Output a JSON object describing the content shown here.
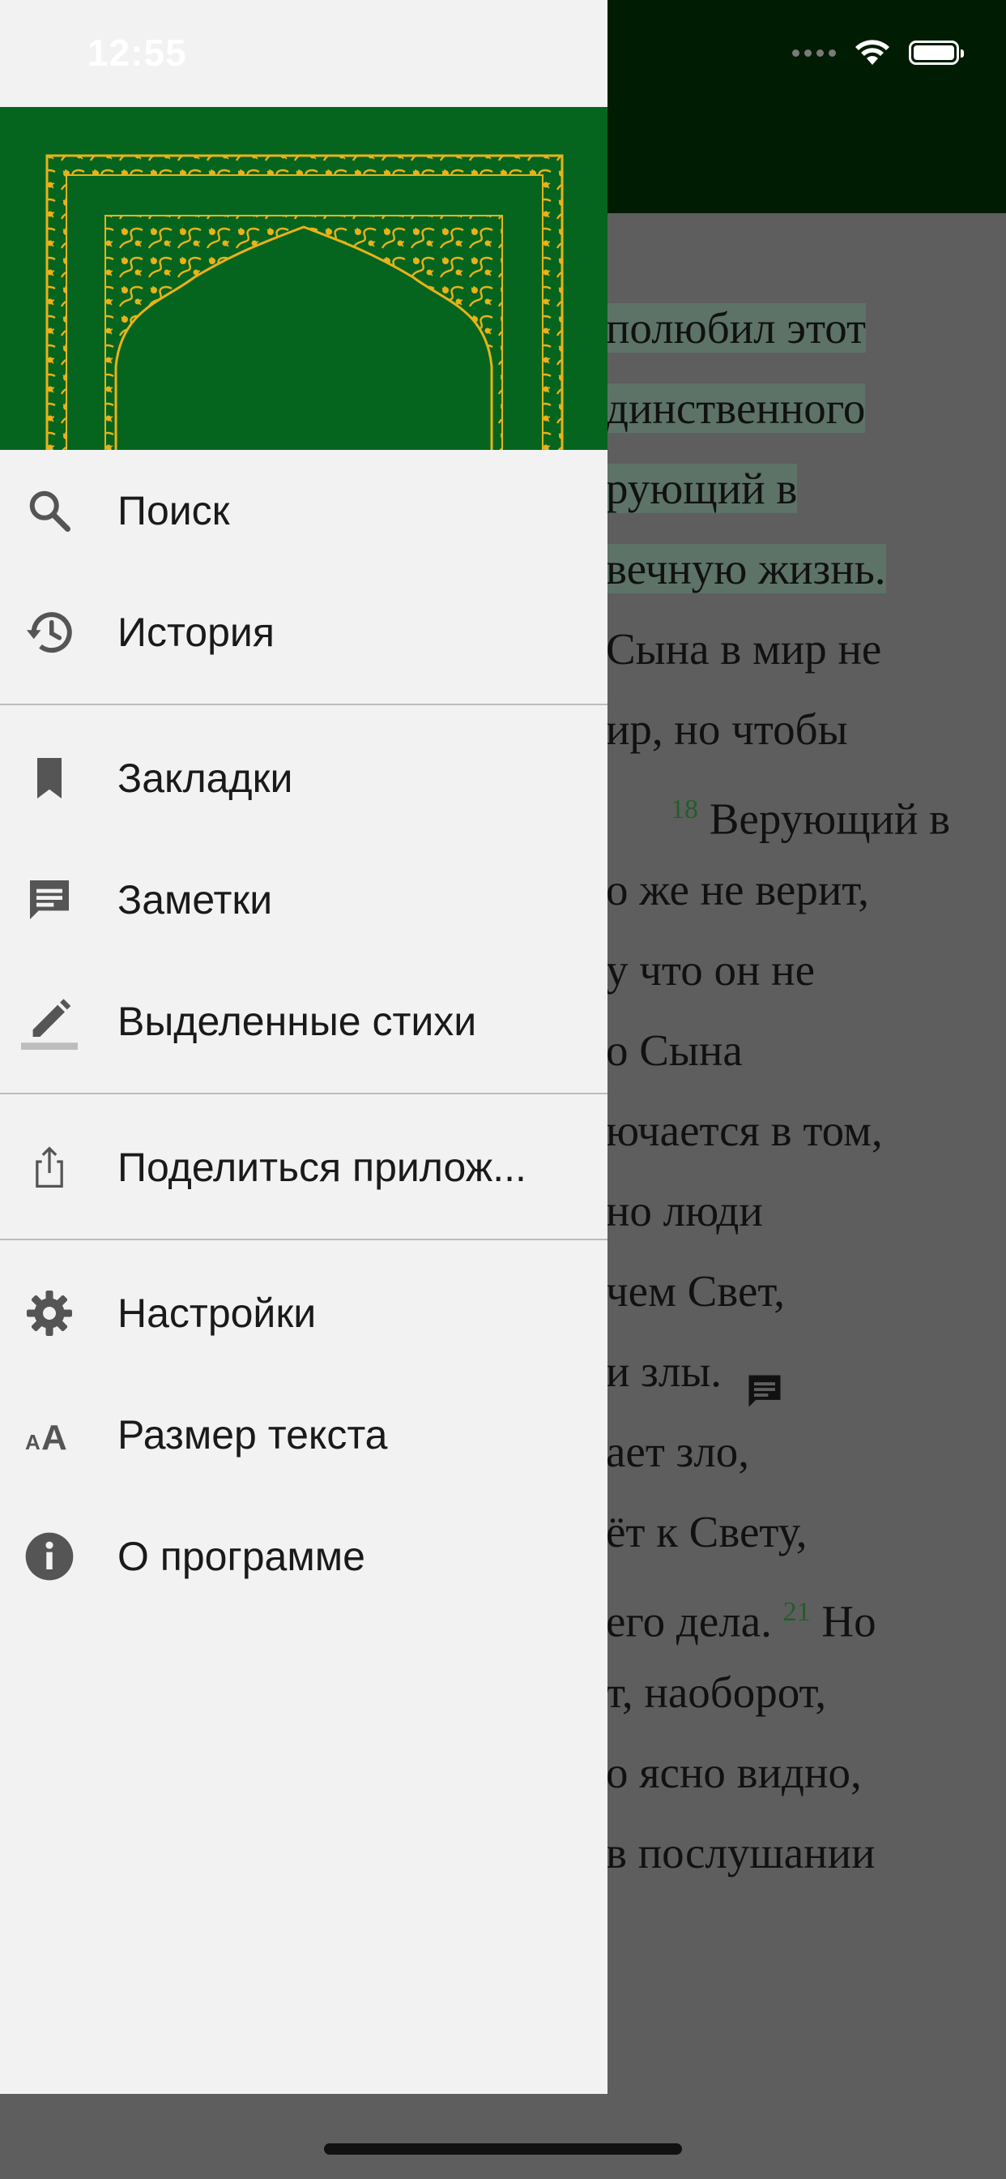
{
  "status_bar": {
    "time": "12:55"
  },
  "reader": {
    "lines": [
      {
        "t": "полюбил этот",
        "hl": true
      },
      {
        "t": "динственного",
        "hl": true
      },
      {
        "t": "рующий в",
        "hl": true
      },
      {
        "t": "вечную жизнь.",
        "hl": true
      },
      {
        "t": "Сына в мир не",
        "hl": false
      },
      {
        "t": "ир, но чтобы",
        "hl": false
      },
      {
        "t": "Верующий в",
        "hl": false,
        "verse": "18"
      },
      {
        "t": "о же не верит,",
        "hl": false
      },
      {
        "t": "у что он не",
        "hl": false
      },
      {
        "t": "о Сына",
        "hl": false
      },
      {
        "t": "ючается в том,",
        "hl": false
      },
      {
        "t": "но люди",
        "hl": false
      },
      {
        "t": "чем Свет,",
        "hl": false
      },
      {
        "t": "и злы.",
        "hl": false
      },
      {
        "t": "ает зло,",
        "hl": false
      },
      {
        "t": "ёт к Свету,",
        "hl": false
      },
      {
        "t": "его дела.",
        "hl": false,
        "verse_after": "21",
        "after": "Но"
      },
      {
        "t": "т, наоборот,",
        "hl": false
      },
      {
        "t": "о ясно видно,",
        "hl": false
      },
      {
        "t": "в послушании",
        "hl": false
      }
    ],
    "highlight_color": "#5d7368",
    "verse_number_color": "#245d2a"
  },
  "drawer": {
    "banner_color": "#05651f",
    "ornament_color": "#e9b21a",
    "menu": {
      "search": "Поиск",
      "history": "История",
      "bookmarks": "Закладки",
      "notes": "Заметки",
      "highlights": "Выделенные стихи",
      "share": "Поделиться прилож...",
      "settings": "Настройки",
      "text_size": "Размер текста",
      "about": "О программе"
    },
    "icons": {
      "search": "search-icon",
      "history": "history-icon",
      "bookmarks": "bookmark-icon",
      "notes": "note-icon",
      "highlights": "highlighter-icon",
      "share": "share-icon",
      "settings": "gear-icon",
      "text_size": "text-size-icon",
      "about": "info-icon"
    }
  }
}
